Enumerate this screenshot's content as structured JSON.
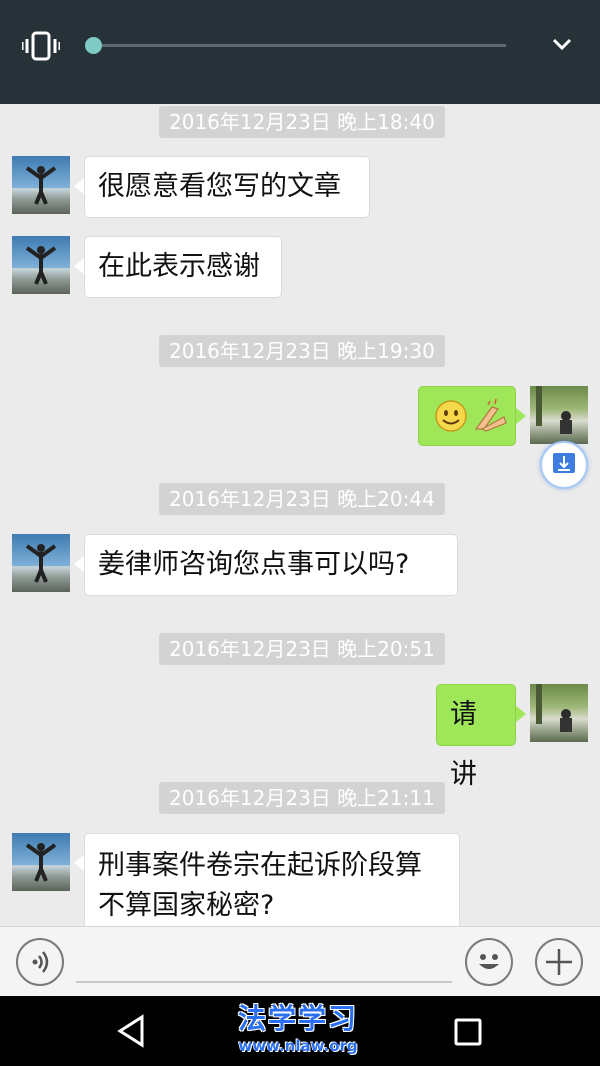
{
  "volume": {
    "mode_icon": "vibrate-icon",
    "expand_icon": "chevron-down-icon"
  },
  "messages": [
    {
      "type": "time",
      "text": "2016年12月23日 晚上18:40"
    },
    {
      "type": "in",
      "text": "很愿意看您写的文章"
    },
    {
      "type": "in",
      "text": "在此表示感谢"
    },
    {
      "type": "time",
      "text": "2016年12月23日 晚上19:30"
    },
    {
      "type": "out",
      "text": "",
      "emoji": [
        "smile-emoji",
        "clap-hands-emoji"
      ]
    },
    {
      "type": "time",
      "text": "2016年12月23日 晚上20:44"
    },
    {
      "type": "in",
      "text": "姜律师咨询您点事可以吗?"
    },
    {
      "type": "time",
      "text": "2016年12月23日 晚上20:51"
    },
    {
      "type": "out",
      "text": "请讲"
    },
    {
      "type": "time",
      "text": "2016年12月23日 晚上21:11"
    },
    {
      "type": "in",
      "text_line1": "刑事案件卷宗在起诉阶段算",
      "text_line2": "不算国家秘密?"
    }
  ],
  "input": {
    "voice_icon": "voice-icon",
    "emoji_icon": "emoji-icon",
    "add_icon": "plus-icon",
    "value": ""
  },
  "watermark": {
    "title": "法学学习",
    "url": "www.nlaw.org"
  },
  "nav": {
    "back_icon": "back-icon",
    "recents_icon": "recents-icon"
  }
}
